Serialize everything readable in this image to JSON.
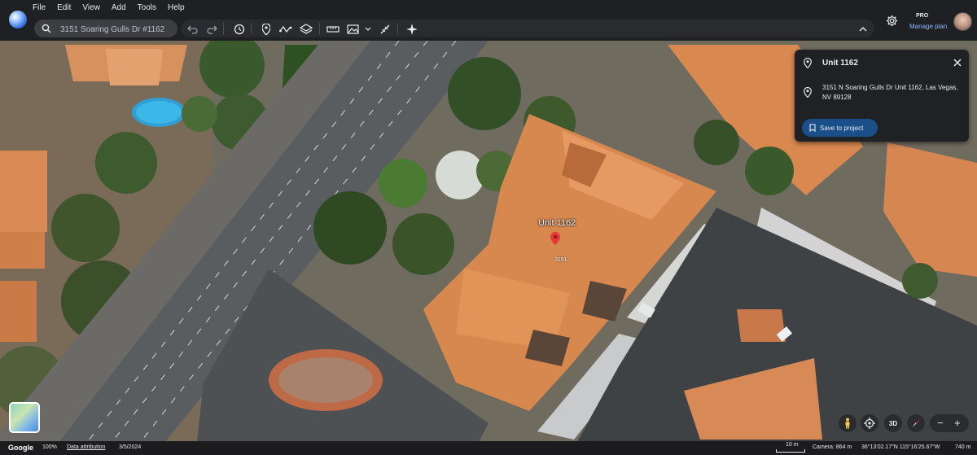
{
  "menu": [
    "File",
    "Edit",
    "View",
    "Add",
    "Tools",
    "Help"
  ],
  "search": {
    "value": "3151 Soaring Gulls Dr #1162"
  },
  "toolbar_icons": [
    "undo-icon",
    "redo-icon",
    "history-icon",
    "placemark-icon",
    "path-icon",
    "layers-icon",
    "ruler-icon",
    "image-overlay-icon",
    "more-icon",
    "magic-icon",
    "collapse-icon"
  ],
  "account": {
    "badge": "PRO",
    "plan_link": "Manage plan"
  },
  "place_card": {
    "title": "Unit 1162",
    "address": "3151 N Soaring Gulls Dr Unit 1162, Las Vegas, NV 89128",
    "save_label": "Save to project"
  },
  "map": {
    "unit_label": "Unit 1162",
    "building_label": "3151",
    "view_toggle": "3D"
  },
  "status": {
    "brand": "Google",
    "zoom": "100%",
    "attribution": "Data attribution",
    "date": "3/5/2024",
    "scale": "10 m",
    "camera": "Camera: 864 m",
    "coords": "36°13'02.17\"N 115°16'25.67\"W",
    "elevation": "740 m"
  },
  "colors": {
    "accent": "#8ab4f8",
    "save_button": "#1a4f8a",
    "pin": "#e53935"
  }
}
